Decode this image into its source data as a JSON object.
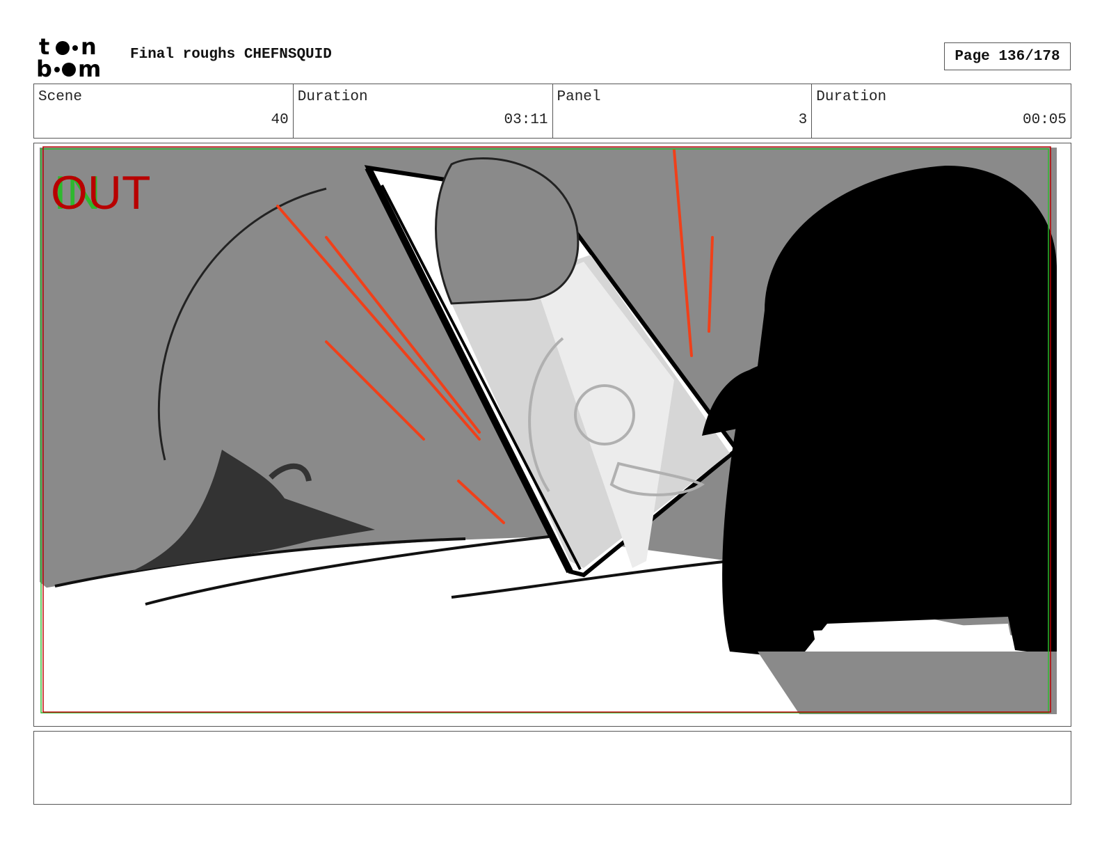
{
  "header": {
    "title": "Final roughs CHEFNSQUID",
    "page": "Page 136/178"
  },
  "info": {
    "scene_label": "Scene",
    "scene_value": "40",
    "scene_duration_label": "Duration",
    "scene_duration_value": "03:11",
    "panel_label": "Panel",
    "panel_value": "3",
    "panel_duration_label": "Duration",
    "panel_duration_value": "00:05"
  },
  "panel": {
    "in_marker": "IN",
    "out_marker": "OUT"
  },
  "notes": "",
  "colors": {
    "in_marker": "#2eb82e",
    "out_marker": "#b80000",
    "speed_lines": "#f0401a",
    "background_gray": "#8a8a8a"
  }
}
